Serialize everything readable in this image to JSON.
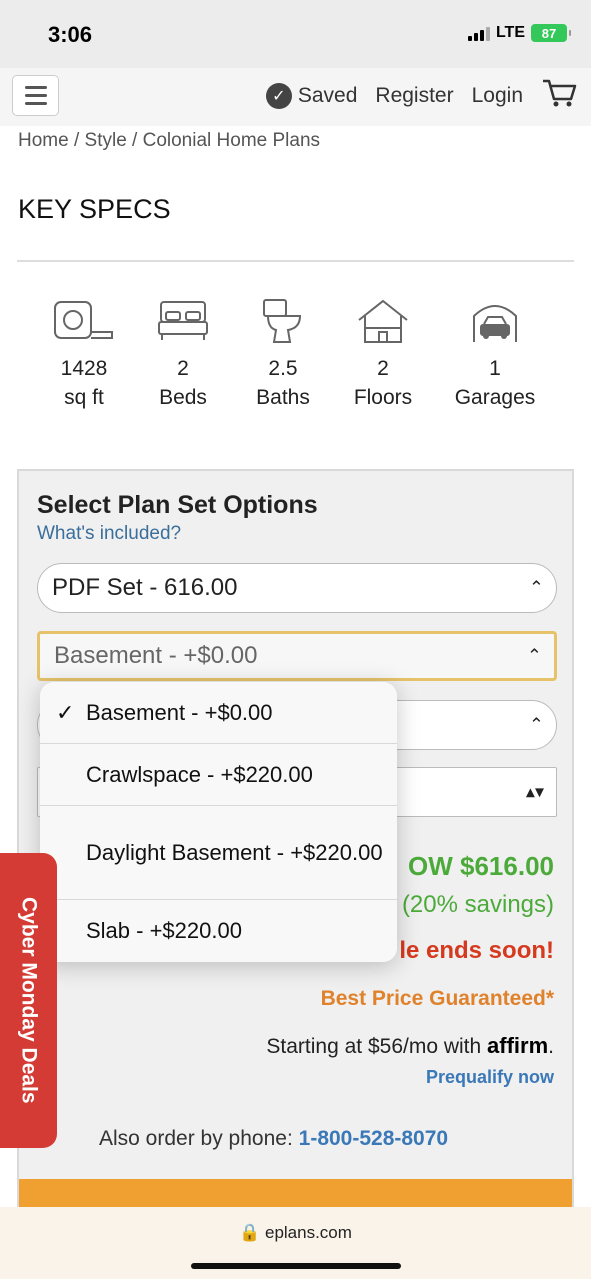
{
  "status": {
    "time": "3:06",
    "network": "LTE",
    "battery": "87"
  },
  "nav": {
    "saved": "Saved",
    "register": "Register",
    "login": "Login"
  },
  "breadcrumb": "Home / Style / Colonial Home Plans",
  "key_specs_title": "KEY SPECS",
  "specs": [
    {
      "icon": "tape-measure-icon",
      "value": "1428",
      "label": "sq ft"
    },
    {
      "icon": "bed-icon",
      "value": "2",
      "label": "Beds"
    },
    {
      "icon": "toilet-icon",
      "value": "2.5",
      "label": "Baths"
    },
    {
      "icon": "house-icon",
      "value": "2",
      "label": "Floors"
    },
    {
      "icon": "garage-icon",
      "value": "1",
      "label": "Garages"
    }
  ],
  "plan_options": {
    "title": "Select Plan Set Options",
    "whats_included": "What's included?",
    "plan_set_select": "PDF Set - 616.00",
    "foundation_select": "Basement - +$0.00"
  },
  "foundation_dropdown": [
    {
      "label": "Basement - +$0.00",
      "selected": true
    },
    {
      "label": "Crawlspace - +$220.00",
      "selected": false
    },
    {
      "label": "Daylight Basement - +$220.00",
      "selected": false
    },
    {
      "label": "Slab - +$220.00",
      "selected": false
    }
  ],
  "pricing": {
    "now_price": "OW $616.00",
    "savings": "(20% savings)",
    "sale": "le ends soon!",
    "guaranteed": "Best Price Guaranteed*",
    "affirm_prefix": "Starting at $56/mo with",
    "affirm_logo": "affirm",
    "prequalify": "Prequalify now",
    "phone_prefix": "Also order by phone:",
    "phone_number": "1-800-528-8070"
  },
  "cyber_tab": "Cyber Monday Deals",
  "url": "eplans.com",
  "colors": {
    "green": "#4caa3a",
    "red": "#d63a1e",
    "orange": "#e0822b",
    "link": "#3a78b8",
    "tab": "#d43b34"
  }
}
